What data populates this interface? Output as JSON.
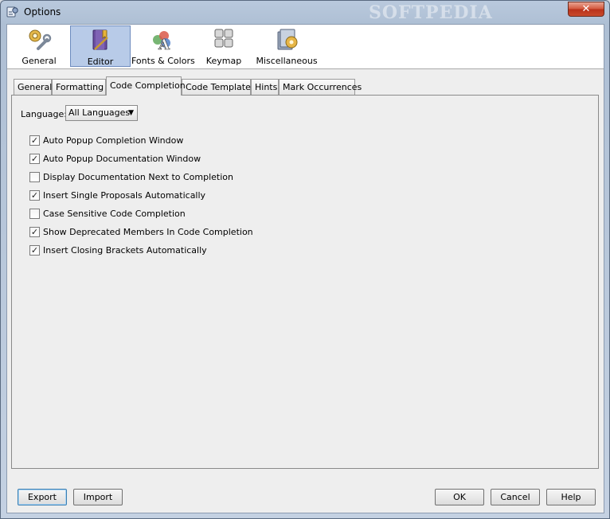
{
  "window": {
    "title": "Options",
    "watermark": "SOFTPEDIA",
    "close_label": "✕"
  },
  "categories": [
    {
      "label": "General",
      "icon": "gear-wrench-icon",
      "selected": false
    },
    {
      "label": "Editor",
      "icon": "editor-notebook-icon",
      "selected": true
    },
    {
      "label": "Fonts & Colors",
      "icon": "fonts-colors-icon",
      "selected": false
    },
    {
      "label": "Keymap",
      "icon": "keyboard-icon",
      "selected": false
    },
    {
      "label": "Miscellaneous",
      "icon": "miscellaneous-icon",
      "selected": false
    }
  ],
  "tabs": [
    {
      "label": "General",
      "active": false
    },
    {
      "label": "Formatting",
      "active": false
    },
    {
      "label": "Code Completion",
      "active": true
    },
    {
      "label": "Code Templates",
      "active": false
    },
    {
      "label": "Hints",
      "active": false
    },
    {
      "label": "Mark Occurrences",
      "active": false
    }
  ],
  "language": {
    "label": "Language:",
    "value": "All Languages"
  },
  "options": [
    {
      "label": "Auto Popup Completion Window",
      "checked": true
    },
    {
      "label": "Auto Popup Documentation Window",
      "checked": true
    },
    {
      "label": "Display Documentation Next to Completion",
      "checked": false
    },
    {
      "label": "Insert Single Proposals Automatically",
      "checked": true
    },
    {
      "label": "Case Sensitive Code Completion",
      "checked": false
    },
    {
      "label": "Show Deprecated Members In Code Completion",
      "checked": true
    },
    {
      "label": "Insert Closing Brackets Automatically",
      "checked": true
    }
  ],
  "buttons": {
    "export": "Export",
    "import": "Import",
    "ok": "OK",
    "cancel": "Cancel",
    "help": "Help"
  },
  "colors": {
    "selected_category_bg": "#b8cbe8",
    "title_bar": "#b9c9dd",
    "close_button": "#c94a2c"
  }
}
